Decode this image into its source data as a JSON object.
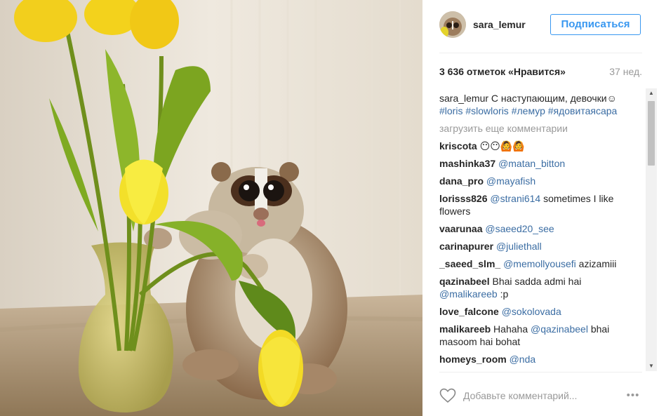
{
  "post": {
    "username": "sara_lemur",
    "follow_label": "Подписаться",
    "likes": "3 636 отметок «Нравится»",
    "age": "37 нед.",
    "caption_user": "sara_lemur",
    "caption_text": " С наступающим, девочки☺",
    "caption_tags": "#loris #slowloris #лемур #ядовитаясара",
    "load_more": "загрузить еще комментарии",
    "comment_placeholder": "Добавьте комментарий...",
    "more_icon": "•••"
  },
  "comments": [
    {
      "user": "kriscota",
      "mention": "",
      "text": " 😶😶🙆🙆"
    },
    {
      "user": "mashinka37",
      "mention": "@matan_bitton",
      "text": ""
    },
    {
      "user": "dana_pro",
      "mention": "@mayafish",
      "text": ""
    },
    {
      "user": "lorisss826",
      "mention": "@strani614",
      "text": " sometimes I like flowers"
    },
    {
      "user": "vaarunaa",
      "mention": "@saeed20_see",
      "text": ""
    },
    {
      "user": "carinapurer",
      "mention": "@juliethall",
      "text": ""
    },
    {
      "user": "_saeed_slm_",
      "mention": "@memollyousefi",
      "text": " azizamiii"
    },
    {
      "user": "qazinabeel",
      "mention": "@malikareeb",
      "text": " Bhai sadda admi hai",
      "mention_after": true,
      "tail": " :p"
    },
    {
      "user": "love_falcone",
      "mention": "@sokolovada",
      "text": ""
    },
    {
      "user": "malikareeb",
      "mention": "@qazinabeel",
      "text": " bhai masoom hai bohat",
      "prefix": " Hahaha "
    },
    {
      "user": "homeys_room",
      "mention": "@nda",
      "text": ""
    }
  ],
  "colors": {
    "accent": "#3897f0",
    "link": "#3b6da3",
    "muted": "#999999"
  },
  "icons": {
    "heart": "heart-outline-icon",
    "more": "more-options-icon"
  }
}
